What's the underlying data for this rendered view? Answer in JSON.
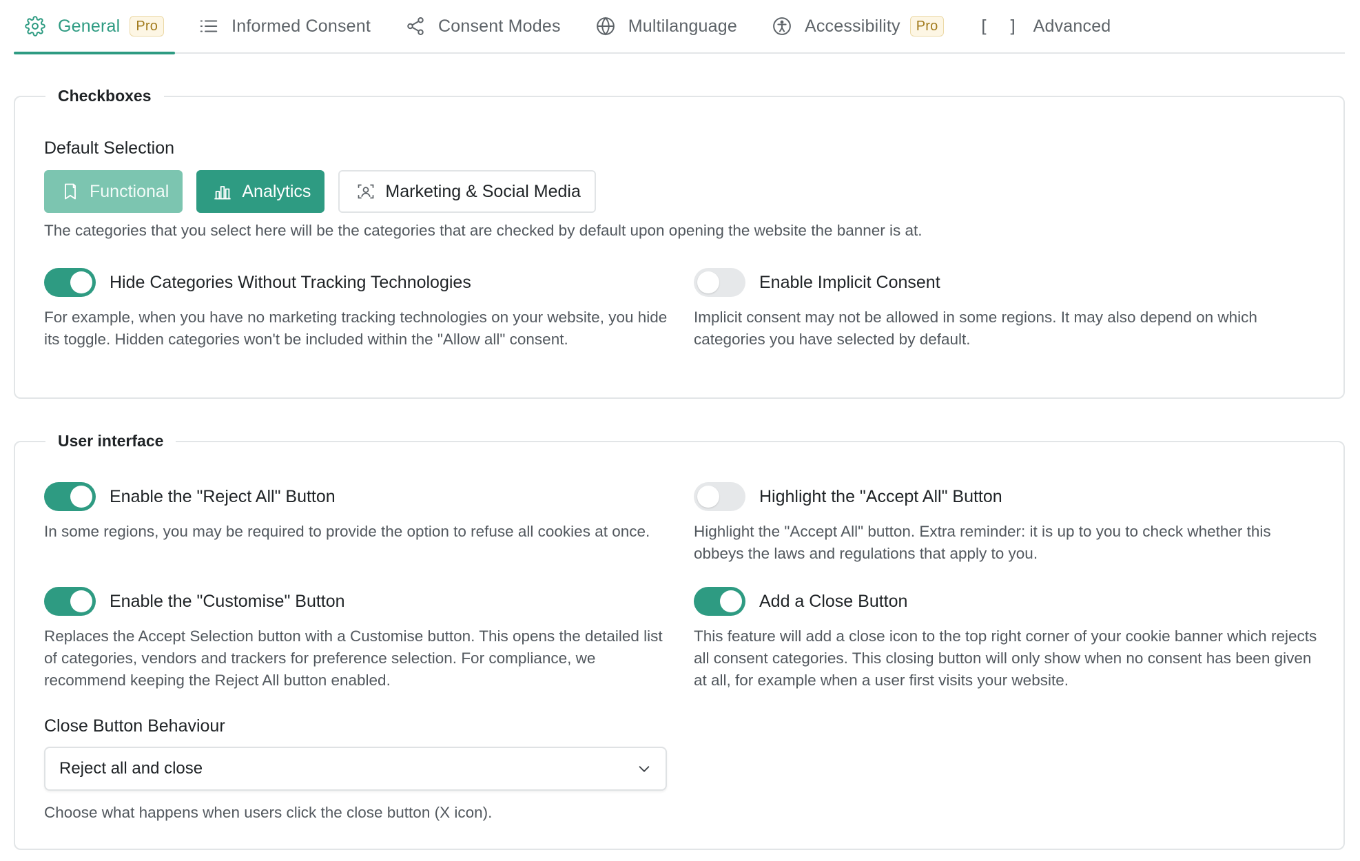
{
  "colors": {
    "accent": "#2e9b82",
    "accent_light": "#7cc5b0",
    "pro_badge": "#a17a1b"
  },
  "tabs": [
    {
      "label": "General",
      "icon": "gear-icon",
      "badge": "Pro",
      "active": true
    },
    {
      "label": "Informed Consent",
      "icon": "list-icon"
    },
    {
      "label": "Consent Modes",
      "icon": "share-icon"
    },
    {
      "label": "Multilanguage",
      "icon": "globe-icon"
    },
    {
      "label": "Accessibility",
      "icon": "accessibility-icon",
      "badge": "Pro"
    },
    {
      "label": "Advanced",
      "icon": "brackets-icon",
      "icon_text": "[ ]"
    }
  ],
  "checkboxes": {
    "legend": "Checkboxes",
    "default_selection_label": "Default Selection",
    "categories": [
      {
        "label": "Functional",
        "icon": "bookmark-icon",
        "state": "selected-disabled"
      },
      {
        "label": "Analytics",
        "icon": "bar-chart-icon",
        "state": "selected"
      },
      {
        "label": "Marketing & Social Media",
        "icon": "user-focus-icon",
        "state": "unselected"
      }
    ],
    "categories_help": "The categories that you select here will be the categories that are checked by default upon opening the website the banner is at.",
    "options": [
      {
        "title": "Hide Categories Without Tracking Technologies",
        "enabled": true,
        "description": "For example, when you have no marketing tracking technologies on your website, you hide its toggle. Hidden categories won't be included within the \"Allow all\" consent."
      },
      {
        "title": "Enable Implicit Consent",
        "enabled": false,
        "description": "Implicit consent may not be allowed in some regions. It may also depend on which categories you have selected by default."
      }
    ]
  },
  "user_interface": {
    "legend": "User interface",
    "options": [
      {
        "title": "Enable the \"Reject All\" Button",
        "enabled": true,
        "description": "In some regions, you may be required to provide the option to refuse all cookies at once."
      },
      {
        "title": "Highlight the \"Accept All\" Button",
        "enabled": false,
        "description": "Highlight the \"Accept All\" button. Extra reminder: it is up to you to check whether this obbeys the laws and regulations that apply to you."
      },
      {
        "title": "Enable the \"Customise\" Button",
        "enabled": true,
        "description": "Replaces the Accept Selection button with a Customise button. This opens the detailed list of categories, vendors and trackers for preference selection. For compliance, we recommend keeping the Reject All button enabled."
      },
      {
        "title": "Add a Close Button",
        "enabled": true,
        "description": "This feature will add a close icon to the top right corner of your cookie banner which rejects all consent categories. This closing button will only show when no consent has been given at all, for example when a user first visits your website."
      }
    ],
    "close_behaviour": {
      "label": "Close Button Behaviour",
      "value": "Reject all and close",
      "help": "Choose what happens when users click the close button (X icon)."
    }
  }
}
